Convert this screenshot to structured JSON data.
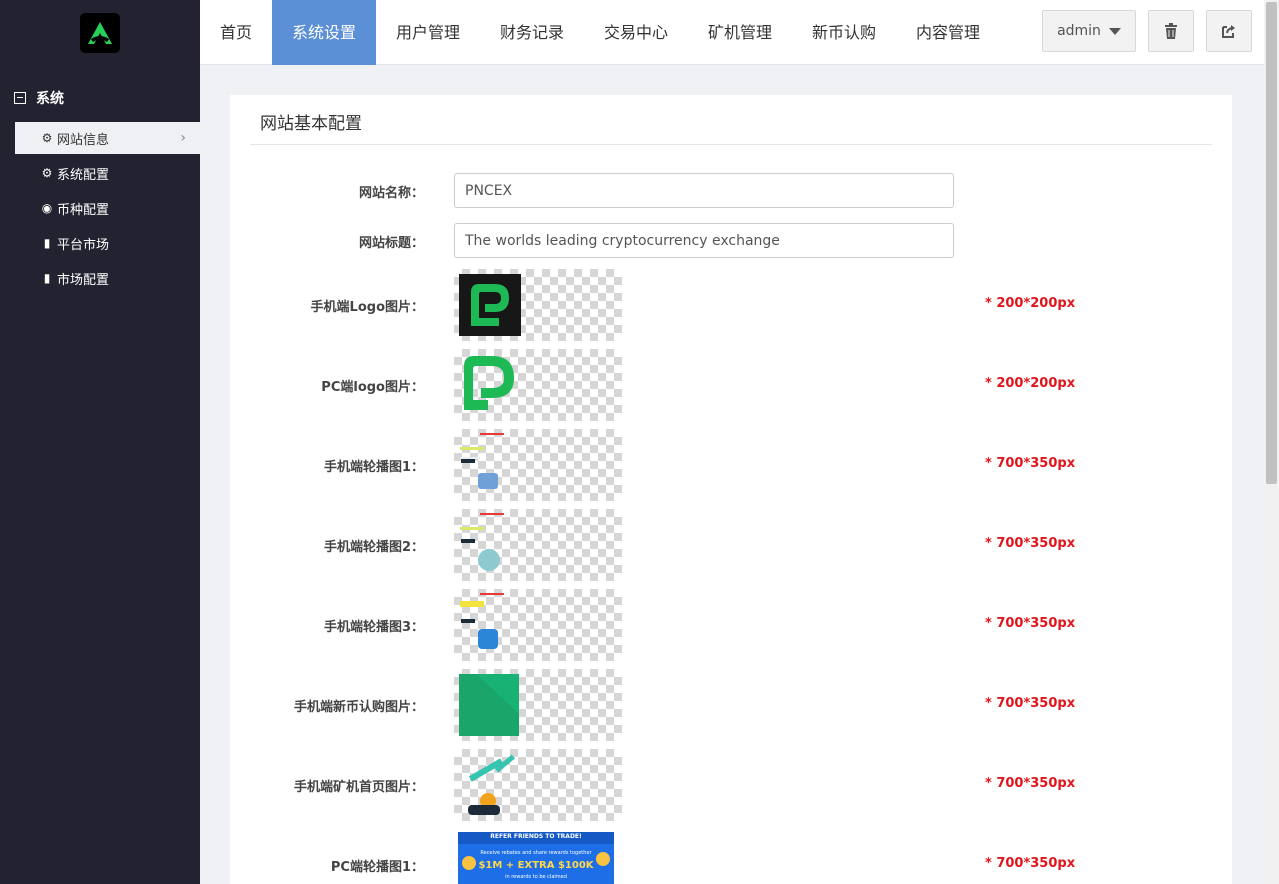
{
  "sidebar": {
    "group_label": "系统",
    "items": [
      {
        "icon": "gear-icon",
        "glyph": "⚙",
        "label": "网站信息",
        "active": true
      },
      {
        "icon": "gear-icon",
        "glyph": "⚙",
        "label": "系统配置",
        "active": false
      },
      {
        "icon": "target-icon",
        "glyph": "◉",
        "label": "币种配置",
        "active": false
      },
      {
        "icon": "bar-chart-icon",
        "glyph": "▮",
        "label": "平台市场",
        "active": false
      },
      {
        "icon": "bar-chart-icon",
        "glyph": "▮",
        "label": "市场配置",
        "active": false
      }
    ]
  },
  "nav": {
    "tabs": [
      "首页",
      "系统设置",
      "用户管理",
      "财务记录",
      "交易中心",
      "矿机管理",
      "新币认购",
      "内容管理"
    ],
    "active_tab": "系统设置",
    "user_label": "admin"
  },
  "panel": {
    "title": "网站基本配置",
    "fields": {
      "site_name": {
        "label": "网站名称：",
        "value": "PNCEX"
      },
      "site_title": {
        "label": "网站标题：",
        "value": "The worlds leading cryptocurrency exchange"
      }
    },
    "images": [
      {
        "label": "手机端Logo图片：",
        "hint": "* 200*200px"
      },
      {
        "label": "PC端logo图片：",
        "hint": "* 200*200px"
      },
      {
        "label": "手机端轮播图1：",
        "hint": "* 700*350px"
      },
      {
        "label": "手机端轮播图2：",
        "hint": "* 700*350px"
      },
      {
        "label": "手机端轮播图3：",
        "hint": "* 700*350px"
      },
      {
        "label": "手机端新币认购图片：",
        "hint": "* 700*350px"
      },
      {
        "label": "手机端矿机首页图片：",
        "hint": "* 700*350px"
      },
      {
        "label": "PC端轮播图1：",
        "hint": "* 700*350px"
      }
    ],
    "banner_text": {
      "line1": "REFER FRIENDS TO TRADE!",
      "line2": "Receive rebates and share rewards together",
      "line3": "$1M + EXTRA $100K",
      "line4": "in rewards to be claimed"
    }
  },
  "colors": {
    "sidebar_bg": "#222230",
    "nav_active": "#5b8fd6",
    "brand_green": "#1db954",
    "hint_red": "#e2141b"
  }
}
